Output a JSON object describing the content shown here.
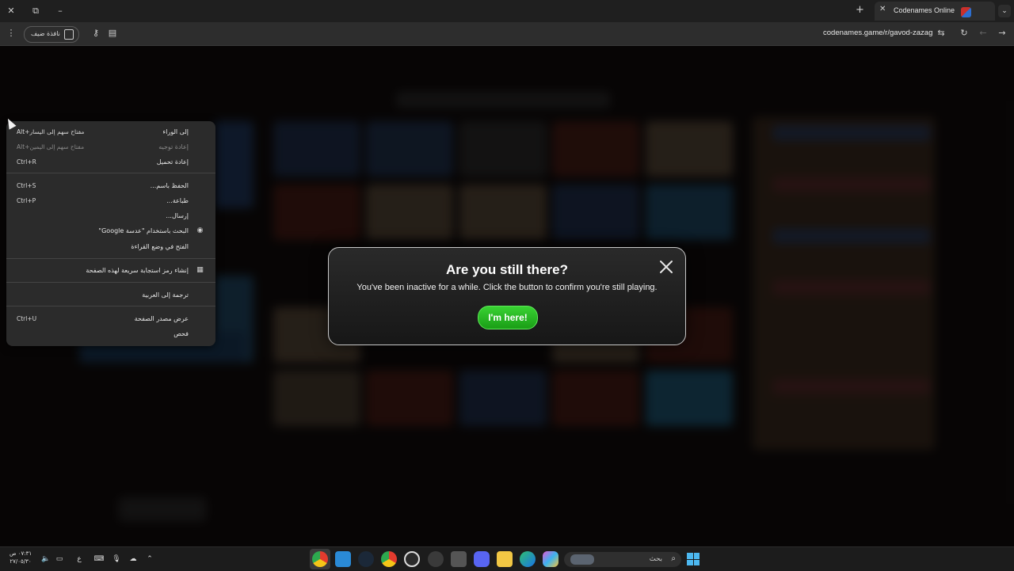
{
  "browser": {
    "tab_title": "Codenames Online",
    "url": "codenames.game/r/gavod-zazag",
    "guest_label": "نافذة ضيف"
  },
  "context_menu": {
    "items": [
      {
        "label": "إلى الوراء",
        "shortcut": "Alt+مفتاح سهم إلى اليسار",
        "disabled": false
      },
      {
        "label": "إعادة توجيه",
        "shortcut": "Alt+مفتاح سهم إلى اليمين",
        "disabled": true
      },
      {
        "label": "إعادة تحميل",
        "shortcut": "Ctrl+R",
        "disabled": false
      },
      {
        "label": "الحفظ باسم...",
        "shortcut": "Ctrl+S",
        "disabled": false
      },
      {
        "label": "طباعة...",
        "shortcut": "Ctrl+P",
        "disabled": false
      },
      {
        "label": "إرسال...",
        "shortcut": "",
        "disabled": false
      },
      {
        "label": "البحث باستخدام \"عدسة Google\"",
        "shortcut": "",
        "disabled": false,
        "icon": "lens-icon"
      },
      {
        "label": "الفتح في وضع القراءة",
        "shortcut": "",
        "disabled": false
      },
      {
        "label": "إنشاء رمز استجابة سريعة لهذه الصفحة",
        "shortcut": "",
        "disabled": false,
        "icon": "qr-code-icon"
      },
      {
        "label": "ترجمة إلى العربية",
        "shortcut": "",
        "disabled": false
      },
      {
        "label": "عرض مصدر الصفحة",
        "shortcut": "Ctrl+U",
        "disabled": false
      },
      {
        "label": "فحص",
        "shortcut": "",
        "disabled": false
      }
    ]
  },
  "modal": {
    "title": "Are you still there?",
    "body": "You've been inactive for a while. Click the button to confirm you're still playing.",
    "button": "I'm here!"
  },
  "taskbar": {
    "time": "٠٧:٣١ ص",
    "date": "٢٧/٠٥/٣٠",
    "lang": "ع",
    "search_placeholder": "بحث"
  },
  "colors": {
    "accent_green": "#22b81c",
    "menu_bg": "#2b2b2b",
    "start_blue": "#4cb8f0"
  }
}
